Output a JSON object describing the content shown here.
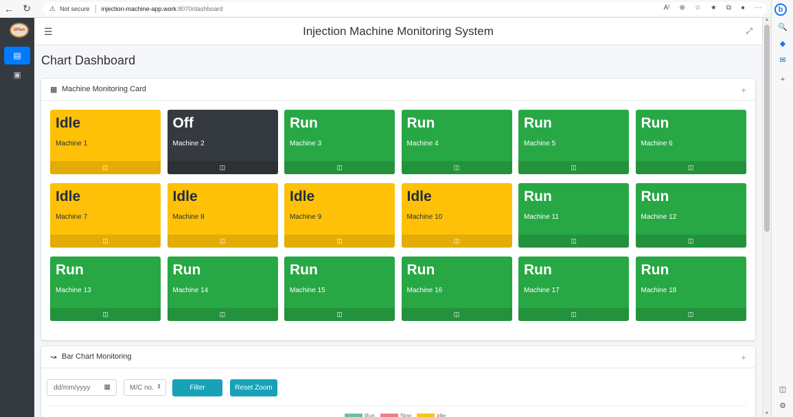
{
  "browser": {
    "security_label": "Not secure",
    "url_host": "injection-machine-app.work",
    "url_path": ":8070/dashboard"
  },
  "app": {
    "title": "Injection Machine Monitoring System",
    "logo_text": "SPlen"
  },
  "page": {
    "title": "Chart Dashboard"
  },
  "monitoring_card": {
    "title": "Machine Monitoring Card",
    "machines": [
      {
        "status": "Idle",
        "name": "Machine 1",
        "state": "idle"
      },
      {
        "status": "Off",
        "name": "Machine 2",
        "state": "off"
      },
      {
        "status": "Run",
        "name": "Machine 3",
        "state": "run"
      },
      {
        "status": "Run",
        "name": "Machine 4",
        "state": "run"
      },
      {
        "status": "Run",
        "name": "Machine 5",
        "state": "run"
      },
      {
        "status": "Run",
        "name": "Machine 6",
        "state": "run"
      },
      {
        "status": "Idle",
        "name": "Machine 7",
        "state": "idle"
      },
      {
        "status": "Idle",
        "name": "Machine 8",
        "state": "idle"
      },
      {
        "status": "Idle",
        "name": "Machine 9",
        "state": "idle"
      },
      {
        "status": "Idle",
        "name": "Machine 10",
        "state": "idle"
      },
      {
        "status": "Run",
        "name": "Machine 11",
        "state": "run"
      },
      {
        "status": "Run",
        "name": "Machine 12",
        "state": "run"
      },
      {
        "status": "Run",
        "name": "Machine 13",
        "state": "run"
      },
      {
        "status": "Run",
        "name": "Machine 14",
        "state": "run"
      },
      {
        "status": "Run",
        "name": "Machine 15",
        "state": "run"
      },
      {
        "status": "Run",
        "name": "Machine 16",
        "state": "run"
      },
      {
        "status": "Run",
        "name": "Machine 17",
        "state": "run"
      },
      {
        "status": "Run",
        "name": "Machine 18",
        "state": "run"
      }
    ]
  },
  "bar_chart_card": {
    "title": "Bar Chart Monitoring",
    "date_placeholder": "dd/mm/yyyy",
    "mc_select_value": "M/C no.",
    "filter_label": "Filter",
    "reset_zoom_label": "Reset Zoom",
    "legend": [
      {
        "label": "Run",
        "color": "#6fbf9f"
      },
      {
        "label": "Stop",
        "color": "#f08080"
      },
      {
        "label": "Idle",
        "color": "#f5c518"
      }
    ]
  },
  "colors": {
    "idle": "#ffc107",
    "off": "#343a40",
    "run": "#28a745",
    "primary": "#007bff",
    "info": "#17a2b8"
  },
  "icons": {
    "tile_footer": "injection-machine-icon",
    "card_header_1": "grid-icon",
    "card_header_2": "line-chart-icon"
  }
}
